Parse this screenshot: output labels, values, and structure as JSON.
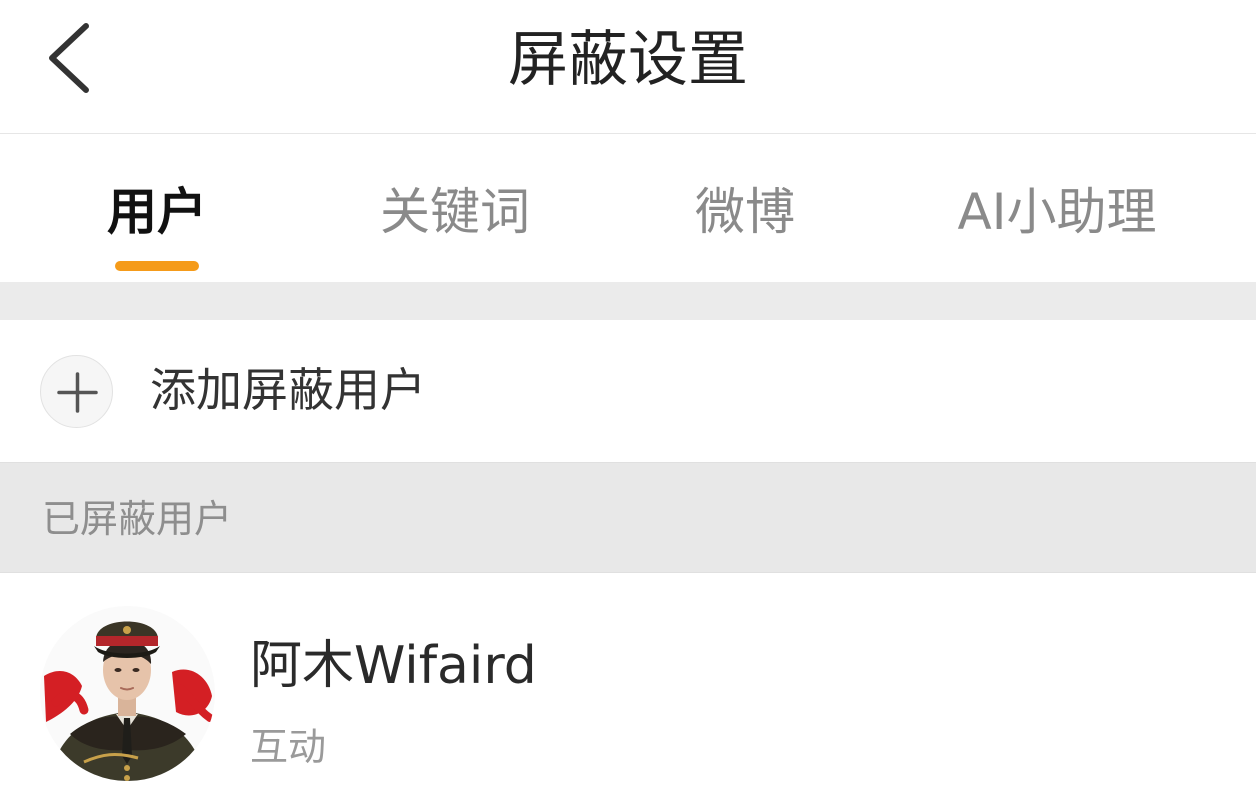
{
  "header": {
    "title": "屏蔽设置",
    "back_icon": "chevron-left-icon"
  },
  "tabs": [
    {
      "label": "用户",
      "active": true
    },
    {
      "label": "关键词",
      "active": false
    },
    {
      "label": "微博",
      "active": false
    },
    {
      "label": "AI小助理",
      "active": false
    }
  ],
  "colors": {
    "accent": "#f59b1a",
    "section_bg": "#e8e8e8",
    "title": "#222222",
    "inactive_tab": "#8a8a8a"
  },
  "add_row": {
    "label": "添加屏蔽用户",
    "icon": "plus-icon"
  },
  "blocked_section": {
    "label": "已屏蔽用户"
  },
  "blocked_users": [
    {
      "name": "阿木Wifaird",
      "subtitle": "互动",
      "avatar": "avatar-photo"
    }
  ]
}
